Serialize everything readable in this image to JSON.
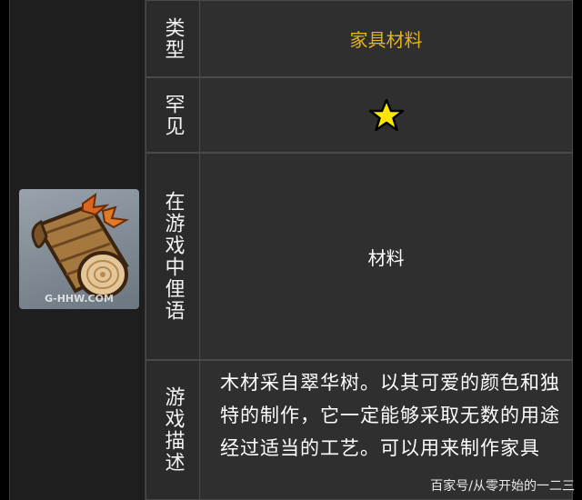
{
  "rows": {
    "type": {
      "label": "类型",
      "value": "家具材料"
    },
    "rarity": {
      "label": "罕见",
      "stars": 1,
      "star_color": "#ffe600"
    },
    "ingame": {
      "label": "在游戏中俚语",
      "value": "材料"
    },
    "desc": {
      "label": "游戏描述",
      "value": "木材采自翠华树。以其可爱的颜色和独特的制作，它一定能够采取无数的用途经过适当的工艺。可以用来制作家具"
    }
  },
  "icon": {
    "name": "wood-log-icon",
    "caption": "G-HHW.COM"
  },
  "watermark": "百家号/从零开始的一二三"
}
